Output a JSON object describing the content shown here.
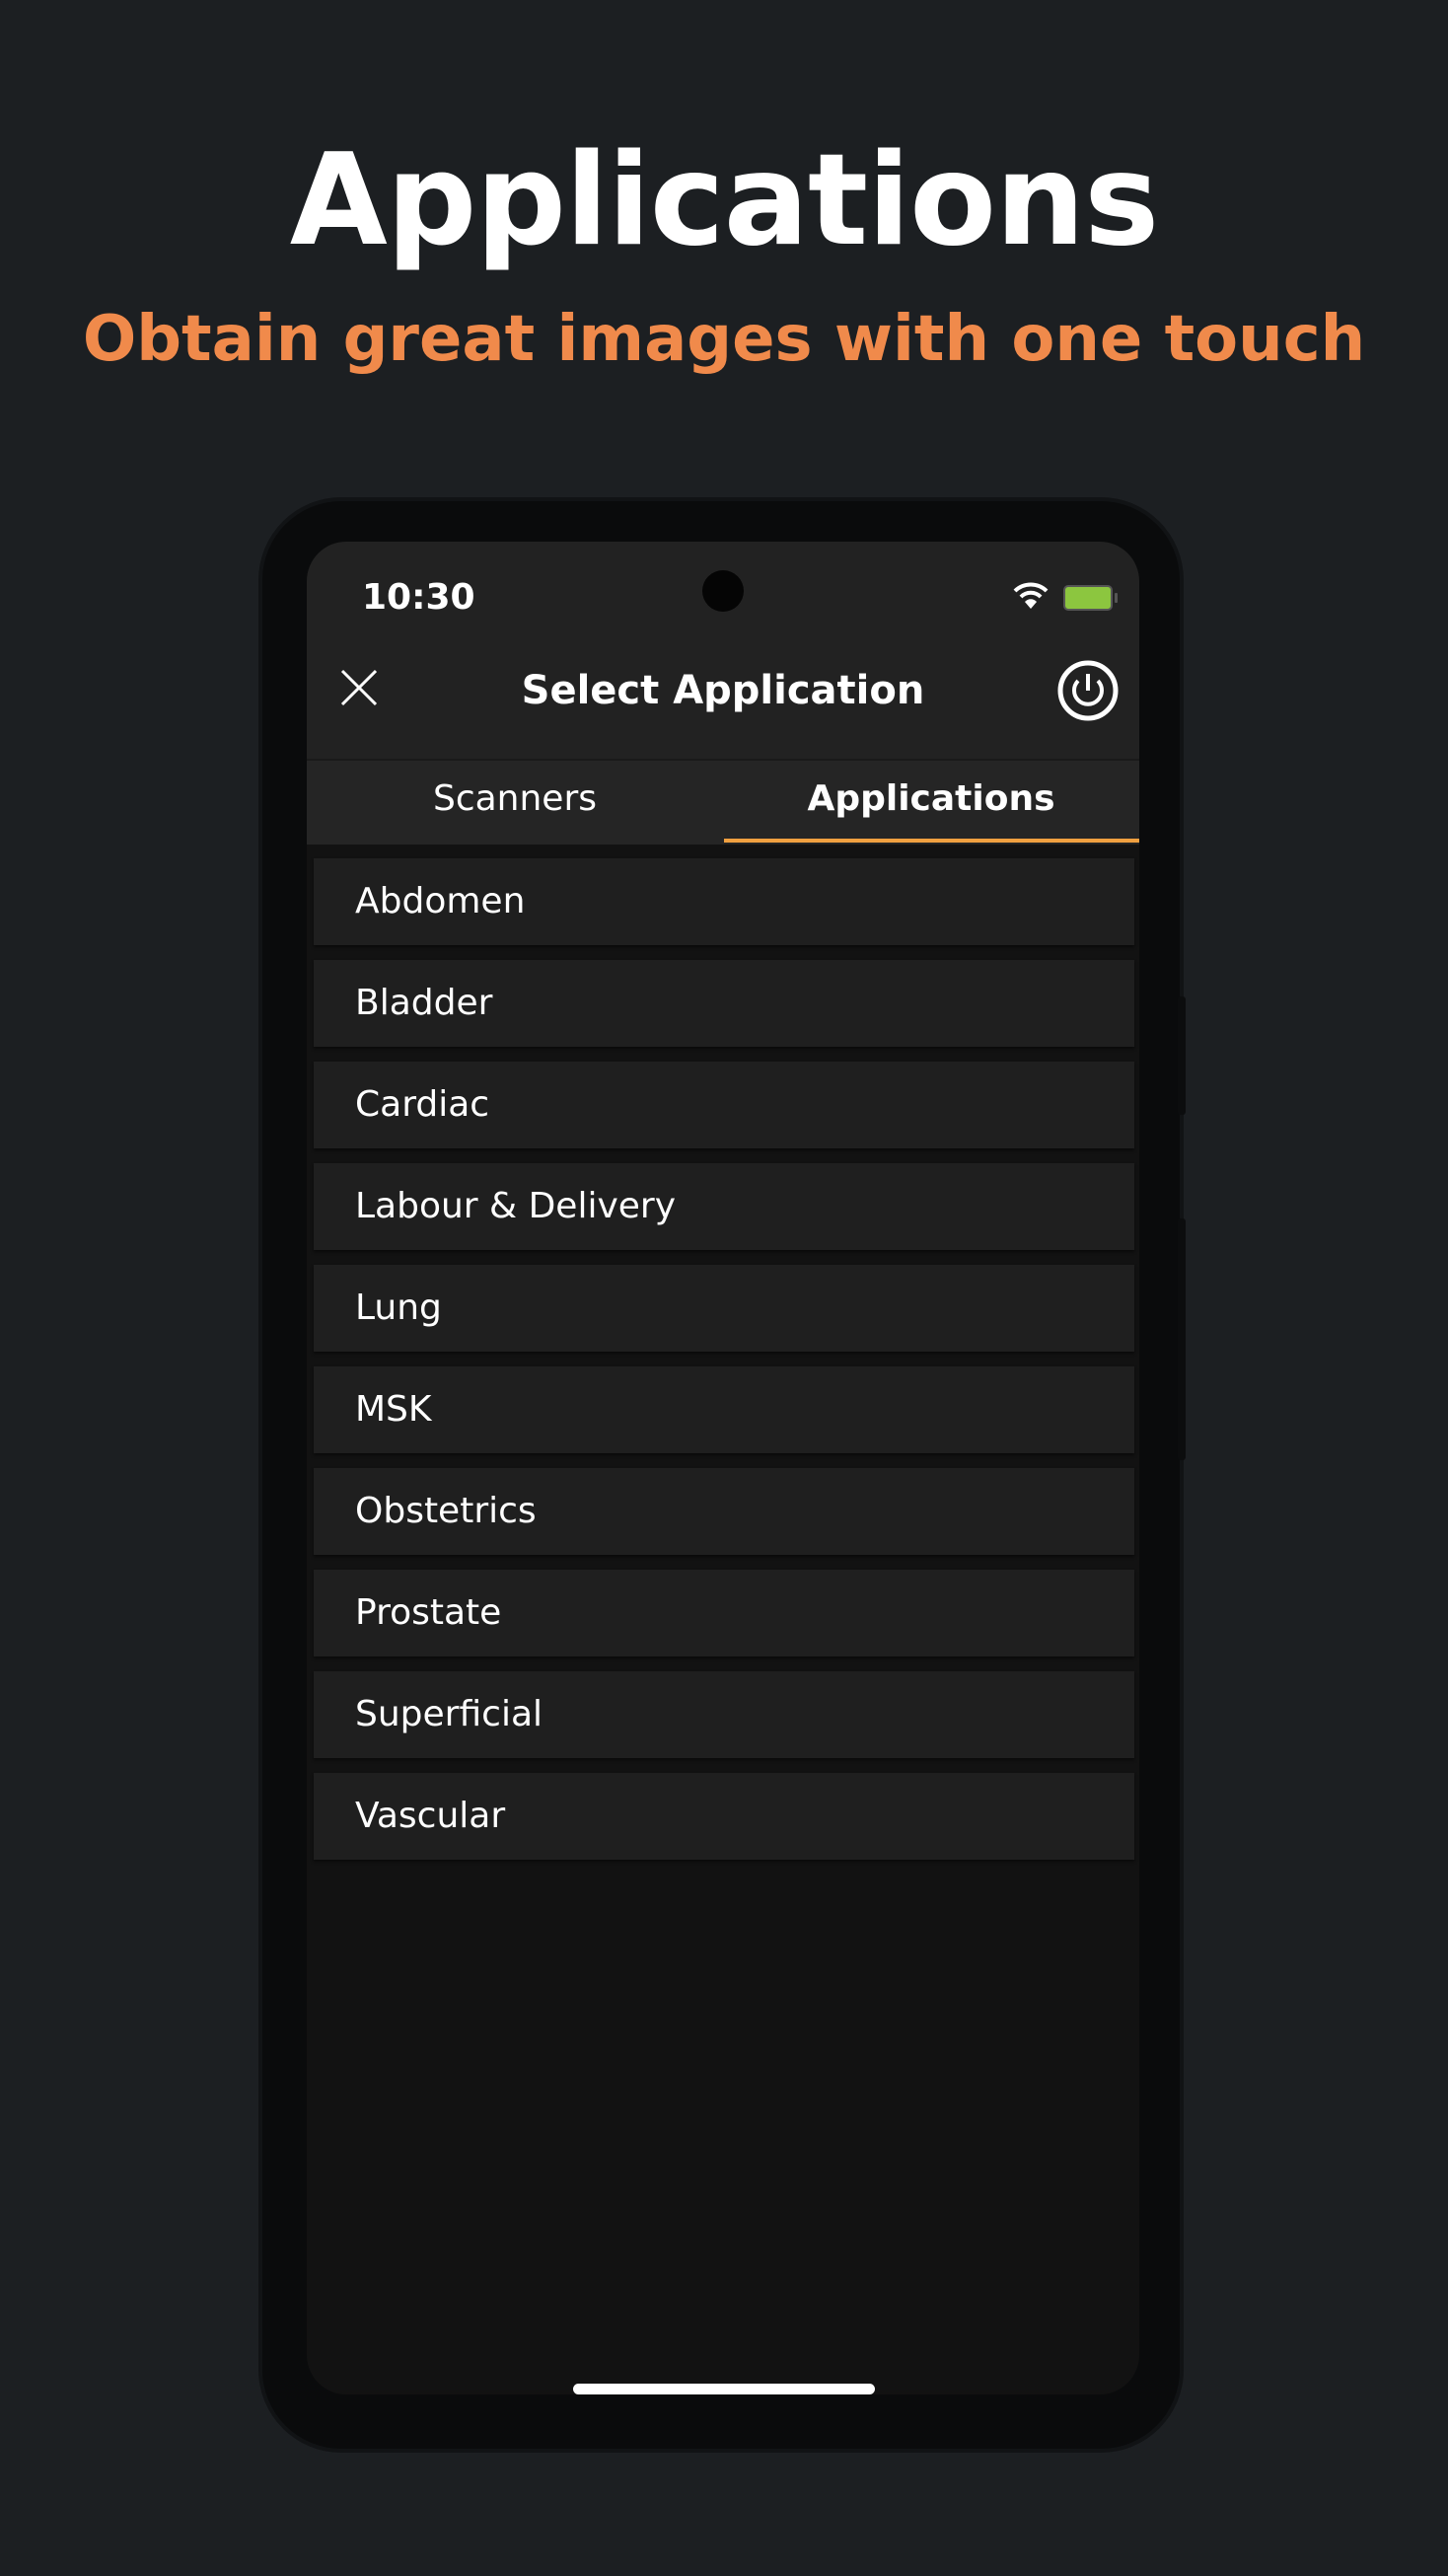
{
  "hero": {
    "title": "Applications",
    "subtitle": "Obtain great images with one touch"
  },
  "colors": {
    "accent": "#f08a4b",
    "tab_indicator": "#f0a040",
    "battery": "#8cc63f",
    "background": "#1c1f22"
  },
  "status_bar": {
    "time": "10:30",
    "icons": [
      "wifi-icon",
      "battery-icon"
    ]
  },
  "header": {
    "title": "Select Application",
    "left_icon": "close-icon",
    "right_icon": "power-icon"
  },
  "tabs": [
    {
      "label": "Scanners",
      "active": false
    },
    {
      "label": "Applications",
      "active": true
    }
  ],
  "applications": [
    "Abdomen",
    "Bladder",
    "Cardiac",
    "Labour & Delivery",
    "Lung",
    "MSK",
    "Obstetrics",
    "Prostate",
    "Superficial",
    "Vascular"
  ]
}
